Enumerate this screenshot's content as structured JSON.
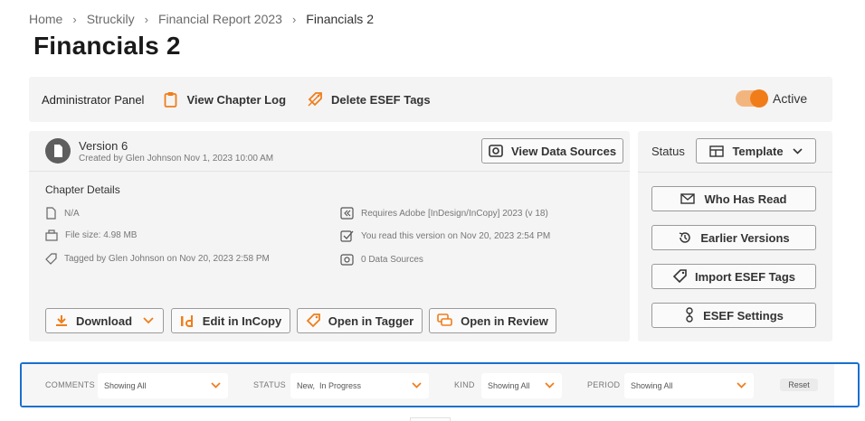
{
  "breadcrumb": [
    "Home",
    "Struckily",
    "Financial Report 2023",
    "Financials 2"
  ],
  "page_title": "Financials 2",
  "admin_panel": {
    "label": "Administrator Panel",
    "view_chapter_log": "View Chapter Log",
    "delete_esef_tags": "Delete ESEF Tags",
    "toggle_state": "on",
    "active_label": "Active"
  },
  "version": {
    "title": "Version 6",
    "subtitle": "Created by Glen Johnson Nov 1, 2023 10:00 AM",
    "view_data_sources": "View Data Sources"
  },
  "chapter_details": {
    "title": "Chapter Details",
    "left": [
      "N/A",
      "File size: 4.98 MB",
      "Tagged by Glen Johnson on Nov 20, 2023 2:58 PM"
    ],
    "right": [
      "Requires Adobe [InDesign/InCopy] 2023 (v 18)",
      "You read this version on Nov 20, 2023 2:54 PM",
      "0 Data Sources"
    ]
  },
  "actions": {
    "download": "Download",
    "edit_incopy": "Edit in InCopy",
    "open_tagger": "Open in Tagger",
    "open_review": "Open in Review"
  },
  "status_panel": {
    "label": "Status",
    "value": "Template",
    "who_has_read": "Who Has Read",
    "earlier_versions": "Earlier Versions",
    "import_esef_tags": "Import ESEF Tags",
    "esef_settings": "ESEF Settings"
  },
  "filters": {
    "comments_label": "COMMENTS",
    "comments_value": "Showing All",
    "status_label": "STATUS",
    "status_value": "New,  In Progress",
    "kind_label": "KIND",
    "kind_value": "Showing All",
    "period_label": "PERIOD",
    "period_value": "Showing All",
    "reset": "Reset"
  },
  "colors": {
    "accent": "#f07d1a",
    "focus_border": "#1a6fd0",
    "panel_bg": "#f4f4f4"
  }
}
